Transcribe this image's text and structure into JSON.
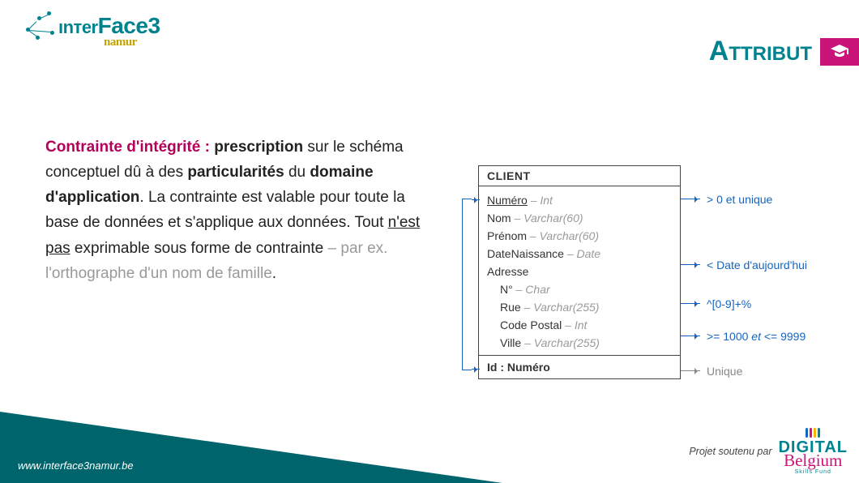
{
  "logo": {
    "line1_a": "ınтer",
    "line1_b": "Face",
    "line1_c": "3",
    "sub": "namur"
  },
  "title": {
    "text": "Attribut"
  },
  "body": {
    "h": "Contrainte d'intégrité :",
    "t1": " ",
    "b1": "prescription",
    "t2": " sur le schéma conceptuel dû à des ",
    "b2": "particularités",
    "t3": " du ",
    "b3": "domaine d'application",
    "t4": ". La contrainte est valable pour toute la base de données et s'applique aux données. Tout ",
    "u1": "n'est pas",
    "t5": " exprimable sous forme de contrainte",
    "g1": " – par ex. l'orthographe d'un nom de famille",
    "t6": "."
  },
  "entity": {
    "title": "CLIENT",
    "rows": [
      {
        "attr": "Numéro",
        "type": "Int",
        "underline": true
      },
      {
        "attr": "Nom",
        "type": "Varchar(60)"
      },
      {
        "attr": "Prénom",
        "type": "Varchar(60)"
      },
      {
        "attr": "DateNaissance",
        "type": "Date"
      }
    ],
    "adresse_label": "Adresse",
    "adresse_rows": [
      {
        "attr": "N°",
        "type": "Char"
      },
      {
        "attr": "Rue",
        "type": "Varchar(255)"
      },
      {
        "attr": "Code Postal",
        "type": "Int"
      },
      {
        "attr": "Ville",
        "type": "Varchar(255)"
      }
    ],
    "id": "Id : Numéro"
  },
  "constraints": {
    "c0": "> 0 et unique",
    "c1": "< Date d'aujourd'hui",
    "c2": "^[0-9]+%",
    "c3_a": ">= 1000 ",
    "c3_b": "et",
    "c3_c": " <= 9999",
    "c4": "Unique"
  },
  "footer": {
    "url": "www.interface3namur.be",
    "proj": "Projet soutenu par",
    "db_top": "DIGITAL",
    "db_mid": "Belgium",
    "db_sub": "Skills Fund"
  }
}
